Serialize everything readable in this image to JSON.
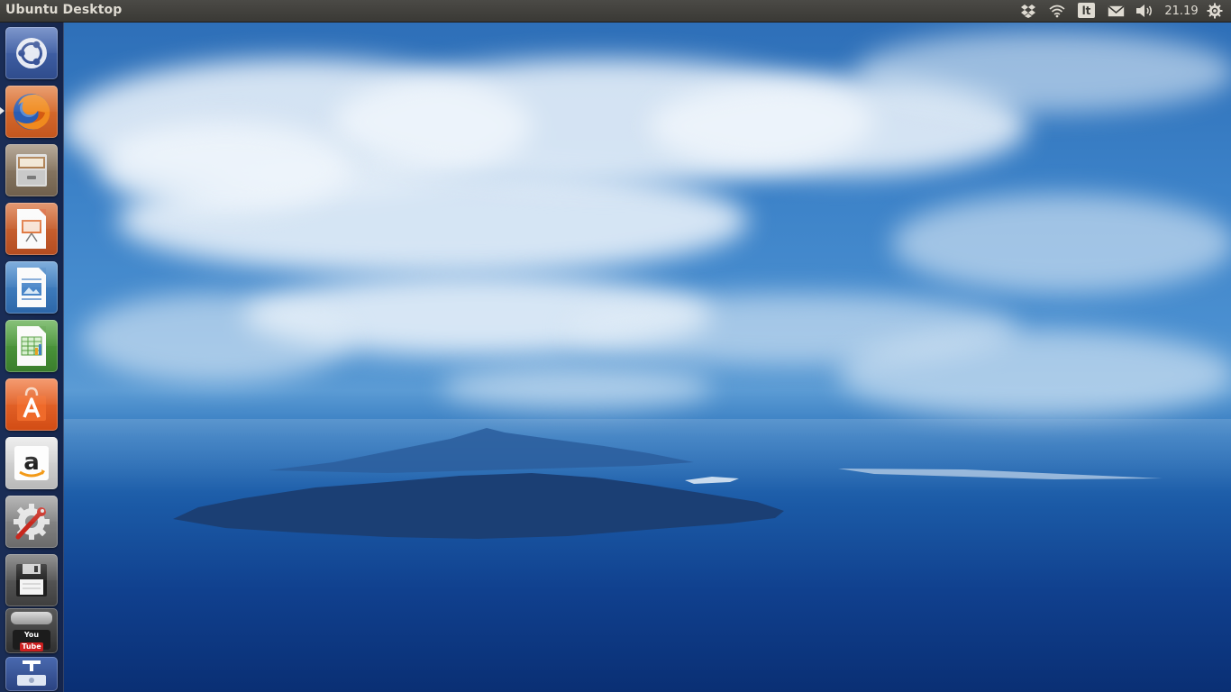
{
  "panel": {
    "title": "Ubuntu Desktop",
    "indicators": {
      "dropbox_icon": "dropbox-icon",
      "network_icon": "wifi-icon",
      "keyboard_layout": "lt",
      "messaging_icon": "envelope-icon",
      "sound_icon": "speaker-icon",
      "clock": "21.19",
      "session_icon": "gear-power-icon"
    }
  },
  "launcher": {
    "items": [
      {
        "name": "dash-home",
        "icon": "ubuntu-logo-icon",
        "bg": "#3f5fa6"
      },
      {
        "name": "firefox",
        "icon": "firefox-icon",
        "bg": "#d4682c",
        "running": true
      },
      {
        "name": "files",
        "icon": "file-cabinet-icon",
        "bg": "#8a7a66"
      },
      {
        "name": "libreoffice-impress",
        "icon": "presentation-icon",
        "bg": "#c9582a"
      },
      {
        "name": "libreoffice-writer",
        "icon": "document-icon",
        "bg": "#3e7fc2"
      },
      {
        "name": "libreoffice-calc",
        "icon": "spreadsheet-icon",
        "bg": "#4d9a3a"
      },
      {
        "name": "software-center",
        "icon": "shopping-bag-icon",
        "bg": "#e35a1f"
      },
      {
        "name": "amazon",
        "icon": "amazon-icon",
        "bg": "#cfcfcf"
      },
      {
        "name": "system-settings",
        "icon": "settings-wrench-icon",
        "bg": "#8a8a8a"
      },
      {
        "name": "save-drive",
        "icon": "floppy-disk-icon",
        "bg": "#5a5a5a"
      },
      {
        "name": "youtube-downloader",
        "icon": "youtube-icon",
        "bg": "#444444"
      },
      {
        "name": "removable-drive",
        "icon": "drive-icon",
        "bg": "#3d5a9e"
      }
    ],
    "youtube_label_top": "You",
    "youtube_label_bottom": "Tube"
  },
  "colors": {
    "panel_bg": "#3c3b37",
    "launcher_bg": "#1e2846",
    "sky": "#3c82c8",
    "sea": "#0f3f8e"
  }
}
